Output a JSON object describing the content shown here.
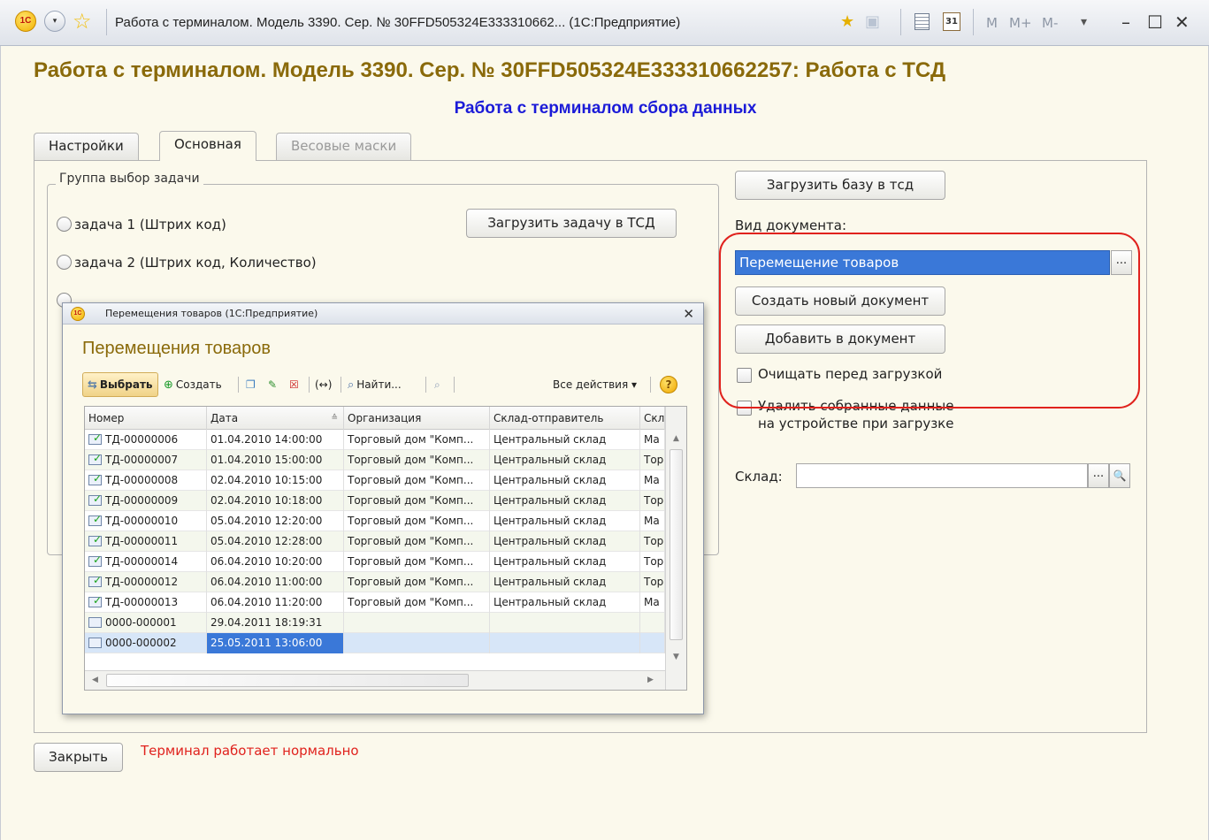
{
  "window": {
    "title": "Работа с терминалом. Модель 3390. Сер. № 30FFD505324E333310662... (1С:Предприятие)",
    "logo": "1С",
    "mem_buttons": [
      "M",
      "M+",
      "M-"
    ],
    "calendar_day": "31",
    "menu_arrow": "▾",
    "favorite_star": "☆",
    "minimize": "–",
    "maximize": "☐",
    "close": "✕"
  },
  "form": {
    "title": "Работа с терминалом. Модель 3390. Сер. № 30FFD505324E333310662257: Работа с ТСД",
    "subtitle": "Работа с терминалом сбора данных",
    "tabs": [
      {
        "label": "Настройки"
      },
      {
        "label": "Основная"
      },
      {
        "label": "Весовые маски"
      }
    ],
    "group": {
      "legend": "Группа выбор задачи",
      "radio1": "задача 1 (Штрих код)",
      "radio2": "задача 2 (Штрих код, Количество)",
      "load_task_button": "Загрузить задачу в ТСД"
    },
    "load_db_button": "Загрузить базу в тсд",
    "doc_type_label": "Вид документа:",
    "doc_type_value": "Перемещение товаров",
    "ellipsis": "...",
    "create_doc_button": "Создать новый документ",
    "add_to_doc_button": "Добавить в документ",
    "clear_before_load": "Очищать перед загрузкой",
    "delete_collected_line1": "Удалить собранные данные",
    "delete_collected_line2": "на устройстве при загрузке",
    "warehouse_label": "Склад:",
    "warehouse_value": "",
    "search_icon": "🔍",
    "close_button": "Закрыть",
    "status": "Терминал работает нормально"
  },
  "dialog": {
    "title": "Перемещения товаров  (1С:Предприятие)",
    "logo": "1С",
    "close": "✕",
    "heading": "Перемещения товаров",
    "toolbar": {
      "select": "Выбрать",
      "create": "Создать",
      "wrap": "(↔)",
      "find": "Найти...",
      "all_actions": "Все действия ▾",
      "help": "?"
    },
    "columns": [
      "Номер",
      "Дата",
      "Организация",
      "Склад-отправитель",
      "Скл"
    ],
    "rows": [
      {
        "number": "ТД-00000006",
        "date": "01.04.2010 14:00:00",
        "org": "Торговый дом \"Комп...",
        "sender": "Центральный склад",
        "wh": "Ма"
      },
      {
        "number": "ТД-00000007",
        "date": "01.04.2010 15:00:00",
        "org": "Торговый дом \"Комп...",
        "sender": "Центральный склад",
        "wh": "Тор"
      },
      {
        "number": "ТД-00000008",
        "date": "02.04.2010 10:15:00",
        "org": "Торговый дом \"Комп...",
        "sender": "Центральный склад",
        "wh": "Ма"
      },
      {
        "number": "ТД-00000009",
        "date": "02.04.2010 10:18:00",
        "org": "Торговый дом \"Комп...",
        "sender": "Центральный склад",
        "wh": "Тор"
      },
      {
        "number": "ТД-00000010",
        "date": "05.04.2010 12:20:00",
        "org": "Торговый дом \"Комп...",
        "sender": "Центральный склад",
        "wh": "Ма"
      },
      {
        "number": "ТД-00000011",
        "date": "05.04.2010 12:28:00",
        "org": "Торговый дом \"Комп...",
        "sender": "Центральный склад",
        "wh": "Тор"
      },
      {
        "number": "ТД-00000014",
        "date": "06.04.2010 10:20:00",
        "org": "Торговый дом \"Комп...",
        "sender": "Центральный склад",
        "wh": "Тор"
      },
      {
        "number": "ТД-00000012",
        "date": "06.04.2010 11:00:00",
        "org": "Торговый дом \"Комп...",
        "sender": "Центральный склад",
        "wh": "Тор"
      },
      {
        "number": "ТД-00000013",
        "date": "06.04.2010 11:20:00",
        "org": "Торговый дом \"Комп...",
        "sender": "Центральный склад",
        "wh": "Ма"
      },
      {
        "number": "0000-000001",
        "date": "29.04.2011 18:19:31",
        "org": "",
        "sender": "",
        "wh": ""
      },
      {
        "number": "0000-000002",
        "date": "25.05.2011 13:06:00",
        "org": "",
        "sender": "",
        "wh": ""
      }
    ],
    "posted_rows": 9,
    "selected_row": 10
  },
  "colors": {
    "title_gold": "#8a6a0a",
    "subtitle_blue": "#1b1bd8",
    "highlight_red": "#e0221d",
    "selection_blue": "#3a78d8",
    "form_bg": "#fbf9ec"
  },
  "icons": [
    "1c-logo-icon",
    "menu-icon",
    "star-icon",
    "favorites-icon",
    "history-icon",
    "calculator-icon",
    "calendar-icon",
    "document-icon",
    "checkmark-icon",
    "create-icon",
    "copy-icon",
    "edit-icon",
    "delete-icon",
    "search-icon",
    "help-icon"
  ]
}
